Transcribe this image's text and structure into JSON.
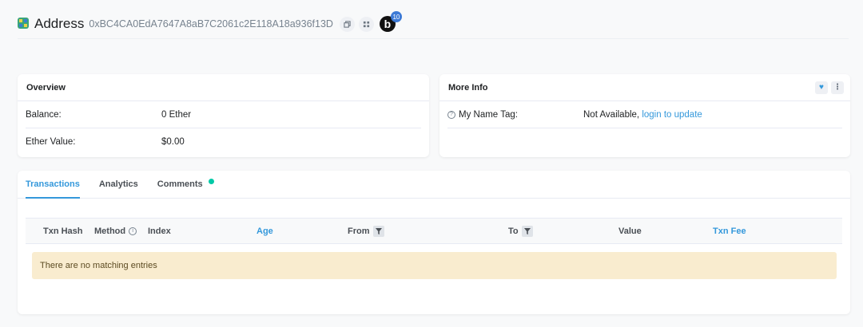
{
  "header": {
    "title": "Address",
    "address": "0xBC4CA0EdA7647A8aB7C2061c2E118A18a936f13D",
    "identicon_icon": "identicon-icon",
    "copy_icon": "copy-icon",
    "qr_icon": "qr-code-icon",
    "blockscan_logo": "b",
    "blockscan_badge": "10"
  },
  "overview": {
    "title": "Overview",
    "rows": [
      {
        "label": "Balance:",
        "value": "0 Ether"
      },
      {
        "label": "Ether Value:",
        "value": "$0.00"
      }
    ]
  },
  "more_info": {
    "title": "More Info",
    "heart_icon": "heart-icon",
    "more_icon": "vertical-dots-icon",
    "name_tag_label": "My Name Tag:",
    "name_tag_value": "Not Available,",
    "name_tag_link": "login to update"
  },
  "tabs": [
    {
      "label": "Transactions",
      "active": true
    },
    {
      "label": "Analytics",
      "active": false
    },
    {
      "label": "Comments",
      "active": false
    }
  ],
  "table": {
    "columns": [
      "Txn Hash",
      "Method",
      "Index",
      "Age",
      "From",
      "To",
      "Value",
      "Txn Fee"
    ],
    "empty_message": "There are no matching entries"
  },
  "colors": {
    "accent": "#3498db",
    "notice_bg": "#f9eccf",
    "comment_dot": "#00c9a7"
  }
}
